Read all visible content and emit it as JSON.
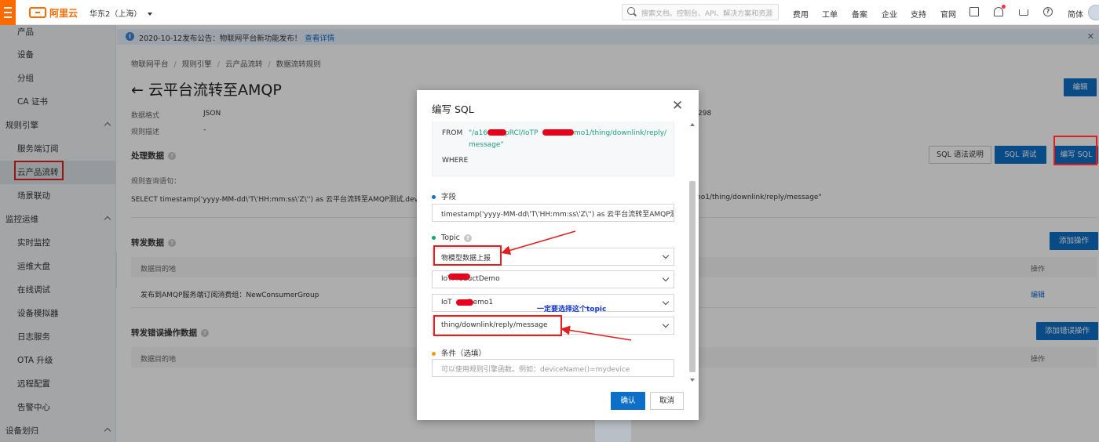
{
  "header": {
    "logo_text": "阿里云",
    "region": "华东2（上海）",
    "search_placeholder": "搜索文档、控制台、API、解决方案和资源",
    "nav": [
      "费用",
      "工单",
      "备案",
      "企业",
      "支持",
      "官网"
    ],
    "language": "简体",
    "icons": [
      "terminal-icon",
      "bell-icon",
      "cart-icon",
      "help-icon"
    ]
  },
  "sidebar": {
    "items": [
      {
        "label": "产品",
        "type": "sub"
      },
      {
        "label": "设备",
        "type": "sub"
      },
      {
        "label": "分组",
        "type": "sub"
      },
      {
        "label": "CA 证书",
        "type": "sub"
      },
      {
        "label": "规则引擎",
        "type": "group"
      },
      {
        "label": "服务端订阅",
        "type": "sub"
      },
      {
        "label": "云产品流转",
        "type": "sub",
        "active": true
      },
      {
        "label": "场景联动",
        "type": "sub"
      },
      {
        "label": "监控运维",
        "type": "group"
      },
      {
        "label": "实时监控",
        "type": "sub"
      },
      {
        "label": "运维大盘",
        "type": "sub"
      },
      {
        "label": "在线调试",
        "type": "sub"
      },
      {
        "label": "设备模拟器",
        "type": "sub"
      },
      {
        "label": "日志服务",
        "type": "sub"
      },
      {
        "label": "OTA 升级",
        "type": "sub"
      },
      {
        "label": "远程配置",
        "type": "sub"
      },
      {
        "label": "告警中心",
        "type": "sub"
      },
      {
        "label": "设备划归",
        "type": "group"
      }
    ]
  },
  "notice": {
    "text": "2020-10-12发布公告：物联网平台新功能发布！",
    "link": "查看详情"
  },
  "breadcrumb": [
    "物联网平台",
    "规则引擎",
    "云产品流转",
    "数据流转规则"
  ],
  "page": {
    "title": "云平台流转至AMQP",
    "edit_button": "编辑",
    "data_format_label": "数据格式",
    "data_format_value": "JSON",
    "rule_desc_label": "规则描述",
    "rule_desc_value": "-",
    "rule_id_fragment": "298",
    "process_section": "处理数据",
    "sql_help_button": "SQL 语法说明",
    "sql_debug_button": "SQL 调试",
    "write_sql_button": "编写 SQL",
    "query_label": "规则查询语句：",
    "query_text": "SELECT timestamp('yyyy-MM-dd\\'T\\'HH:mm:ss\\'Z\\'') as 云平台流转至AMQP测试,deviceName",
    "query_tail": "no1/thing/downlink/reply/message\"",
    "forward_section": "转发数据",
    "add_action_button": "添加操作",
    "col_target": "数据目的地",
    "col_action": "操作",
    "forward_row": "发布到AMQP服务端订阅消费组：NewConsumerGroup",
    "forward_row_action": "编辑",
    "error_section": "转发错误操作数据",
    "add_error_button": "添加错误操作",
    "error_col_target": "数据目的地",
    "error_col_action": "操作"
  },
  "modal": {
    "title": "编写 SQL",
    "from_keyword": "FROM",
    "from_value_line1": "\"/a16",
    "from_value_line1_mid": "pRCl/IoTP",
    "from_value_line1_end": "mo1/thing/downlink/reply/",
    "from_value_line2": "message\"",
    "where_keyword": "WHERE",
    "field_label": "字段",
    "field_value": "timestamp('yyyy-MM-dd\\'T\\'HH:mm:ss\\'Z\\'') as 云平台流转至AMQP测试",
    "topic_label": "Topic",
    "topic_type": "物模型数据上报",
    "topic_product": "IoTProductDemo",
    "topic_device": "IoT",
    "topic_device_end": "Demo1",
    "topic_path": "thing/downlink/reply/message",
    "condition_label": "条件（选填）",
    "condition_placeholder": "可以使用规则引擎函数。例如：deviceName()=mydevice",
    "confirm_button": "确认",
    "cancel_button": "取消",
    "annotation": "一定要选择这个topic"
  },
  "colors": {
    "brand": "#ff6a00",
    "primary": "#0d6fc8",
    "annotation_red": "#e01f1f",
    "annotation_blue": "#1236c8",
    "code_green": "#1aa07a"
  }
}
